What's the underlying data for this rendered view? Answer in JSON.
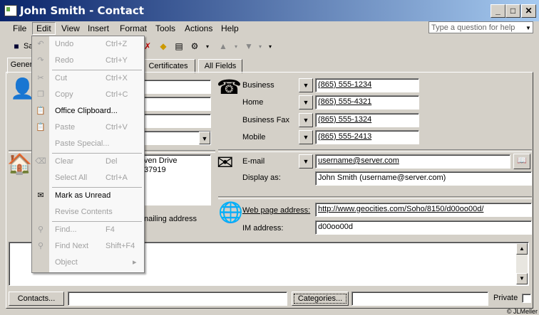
{
  "window": {
    "title": "John Smith - Contact",
    "buttons": [
      "_",
      "□",
      "✕"
    ]
  },
  "menubar": {
    "items": [
      "File",
      "Edit",
      "View",
      "Insert",
      "Format",
      "Tools",
      "Actions",
      "Help"
    ],
    "help_placeholder": "Type a question for help"
  },
  "toolbar": {
    "save_label": "Sa"
  },
  "tabs": [
    "Gener",
    "Certificates",
    "All Fields"
  ],
  "phones": [
    {
      "label": "Business",
      "value": "(865) 555-1234"
    },
    {
      "label": "Home",
      "value": "(865) 555-4321"
    },
    {
      "label": "Business Fax",
      "value": "(865) 555-1324"
    },
    {
      "label": "Mobile",
      "value": "(865) 555-2413"
    }
  ],
  "address": {
    "line1": "ven Drive",
    "line2": "37919",
    "mailing_label": "nailing address"
  },
  "email": {
    "label": "E-mail",
    "value": "username@server.com",
    "display_label": "Display as:",
    "display_value": "John Smith (username@server.com)"
  },
  "web": {
    "label": "Web page address:",
    "value": "http://www.geocities.com/Soho/8150/d00oo00d/",
    "im_label": "IM address:",
    "im_value": "d00oo00d"
  },
  "footer": {
    "contacts_button": "Contacts...",
    "categories_button": "Categories...",
    "private_label": "Private",
    "copyright": "© JLMeller"
  },
  "edit_menu": [
    {
      "label": "Undo",
      "shortcut": "Ctrl+Z",
      "enabled": false,
      "icon": "undo-icon"
    },
    {
      "label": "Redo",
      "shortcut": "Ctrl+Y",
      "enabled": false,
      "icon": "redo-icon"
    },
    {
      "label": "Cut",
      "shortcut": "Ctrl+X",
      "enabled": false,
      "icon": "cut-icon"
    },
    {
      "label": "Copy",
      "shortcut": "Ctrl+C",
      "enabled": false,
      "icon": "copy-icon"
    },
    {
      "label": "Office Clipboard...",
      "shortcut": "",
      "enabled": true,
      "icon": "clipboard-icon"
    },
    {
      "label": "Paste",
      "shortcut": "Ctrl+V",
      "enabled": false,
      "icon": "paste-icon"
    },
    {
      "label": "Paste Special...",
      "shortcut": "",
      "enabled": false,
      "icon": ""
    },
    {
      "label": "Clear",
      "shortcut": "Del",
      "enabled": false,
      "icon": "eraser-icon"
    },
    {
      "label": "Select All",
      "shortcut": "Ctrl+A",
      "enabled": false,
      "icon": ""
    },
    {
      "label": "Mark as Unread",
      "shortcut": "",
      "enabled": true,
      "icon": "envelope-icon"
    },
    {
      "label": "Revise Contents",
      "shortcut": "",
      "enabled": false,
      "icon": ""
    },
    {
      "label": "Find...",
      "shortcut": "F4",
      "enabled": false,
      "icon": "binoculars-icon"
    },
    {
      "label": "Find Next",
      "shortcut": "Shift+F4",
      "enabled": false,
      "icon": "find-next-icon"
    },
    {
      "label": "Object",
      "shortcut": "▸",
      "enabled": false,
      "icon": ""
    }
  ]
}
